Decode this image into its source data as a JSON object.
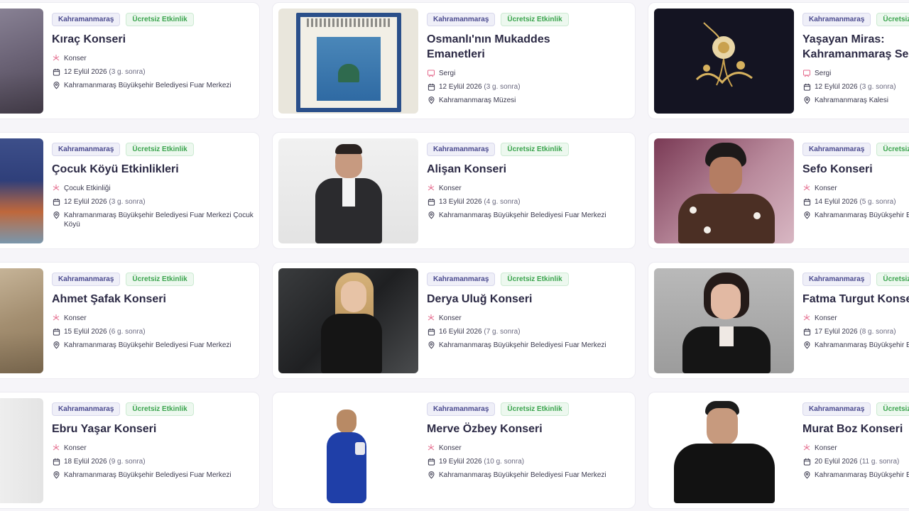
{
  "events": [
    {
      "city": "Kahramanmaraş",
      "price": "Ücretsiz Etkinlik",
      "title": "Kıraç Konseri",
      "category": "Konser",
      "date": "12 Eylül 2026",
      "relative": "(3 g. sonra)",
      "venue": "Kahramanmaraş Büyükşehir Belediyesi Fuar Merkezi"
    },
    {
      "city": "Kahramanmaraş",
      "price": "Ücretsiz Etkinlik",
      "title": "Osmanlı'nın Mukaddes Emanetleri",
      "category": "Sergi",
      "date": "12 Eylül 2026",
      "relative": "(3 g. sonra)",
      "venue": "Kahramanmaraş Müzesi"
    },
    {
      "city": "Kahramanmaraş",
      "price": "Ücretsiz Etkinlik",
      "title": "Yaşayan Miras: Kahramanmaraş Sergisi",
      "category": "Sergi",
      "date": "12 Eylül 2026",
      "relative": "(3 g. sonra)",
      "venue": "Kahramanmaraş Kalesi"
    },
    {
      "city": "Kahramanmaraş",
      "price": "Ücretsiz Etkinlik",
      "title": "Çocuk Köyü Etkinlikleri",
      "category": "Çocuk Etkinliği",
      "date": "12 Eylül 2026",
      "relative": "(3 g. sonra)",
      "venue": "Kahramanmaraş Büyükşehir Belediyesi Fuar Merkezi Çocuk Köyü"
    },
    {
      "city": "Kahramanmaraş",
      "price": "Ücretsiz Etkinlik",
      "title": "Alişan Konseri",
      "category": "Konser",
      "date": "13 Eylül 2026",
      "relative": "(4 g. sonra)",
      "venue": "Kahramanmaraş Büyükşehir Belediyesi Fuar Merkezi"
    },
    {
      "city": "Kahramanmaraş",
      "price": "Ücretsiz Etkinlik",
      "title": "Sefo Konseri",
      "category": "Konser",
      "date": "14 Eylül 2026",
      "relative": "(5 g. sonra)",
      "venue": "Kahramanmaraş Büyükşehir Belediyesi Fuar Merkezi"
    },
    {
      "city": "Kahramanmaraş",
      "price": "Ücretsiz Etkinlik",
      "title": "Ahmet Şafak Konseri",
      "category": "Konser",
      "date": "15 Eylül 2026",
      "relative": "(6 g. sonra)",
      "venue": "Kahramanmaraş Büyükşehir Belediyesi Fuar Merkezi"
    },
    {
      "city": "Kahramanmaraş",
      "price": "Ücretsiz Etkinlik",
      "title": "Derya Uluğ Konseri",
      "category": "Konser",
      "date": "16 Eylül 2026",
      "relative": "(7 g. sonra)",
      "venue": "Kahramanmaraş Büyükşehir Belediyesi Fuar Merkezi"
    },
    {
      "city": "Kahramanmaraş",
      "price": "Ücretsiz Etkinlik",
      "title": "Fatma Turgut Konseri",
      "category": "Konser",
      "date": "17 Eylül 2026",
      "relative": "(8 g. sonra)",
      "venue": "Kahramanmaraş Büyükşehir Belediyesi Fuar Merkezi"
    },
    {
      "city": "Kahramanmaraş",
      "price": "Ücretsiz Etkinlik",
      "title": "Ebru Yaşar Konseri",
      "category": "Konser",
      "date": "18 Eylül 2026",
      "relative": "(9 g. sonra)",
      "venue": "Kahramanmaraş Büyükşehir Belediyesi Fuar Merkezi"
    },
    {
      "city": "Kahramanmaraş",
      "price": "Ücretsiz Etkinlik",
      "title": "Merve Özbey Konseri",
      "category": "Konser",
      "date": "19 Eylül 2026",
      "relative": "(10 g. sonra)",
      "venue": "Kahramanmaraş Büyükşehir Belediyesi Fuar Merkezi"
    },
    {
      "city": "Kahramanmaraş",
      "price": "Ücretsiz Etkinlik",
      "title": "Murat Boz Konseri",
      "category": "Konser",
      "date": "20 Eylül 2026",
      "relative": "(11 g. sonra)",
      "venue": "Kahramanmaraş Büyükşehir Belediyesi Fuar Merkezi"
    }
  ],
  "colors": {
    "accent": "#2c2a45",
    "city_badge": "#4b4b8f",
    "free_badge": "#3aa44d",
    "category_icon": "#e46a8c"
  }
}
